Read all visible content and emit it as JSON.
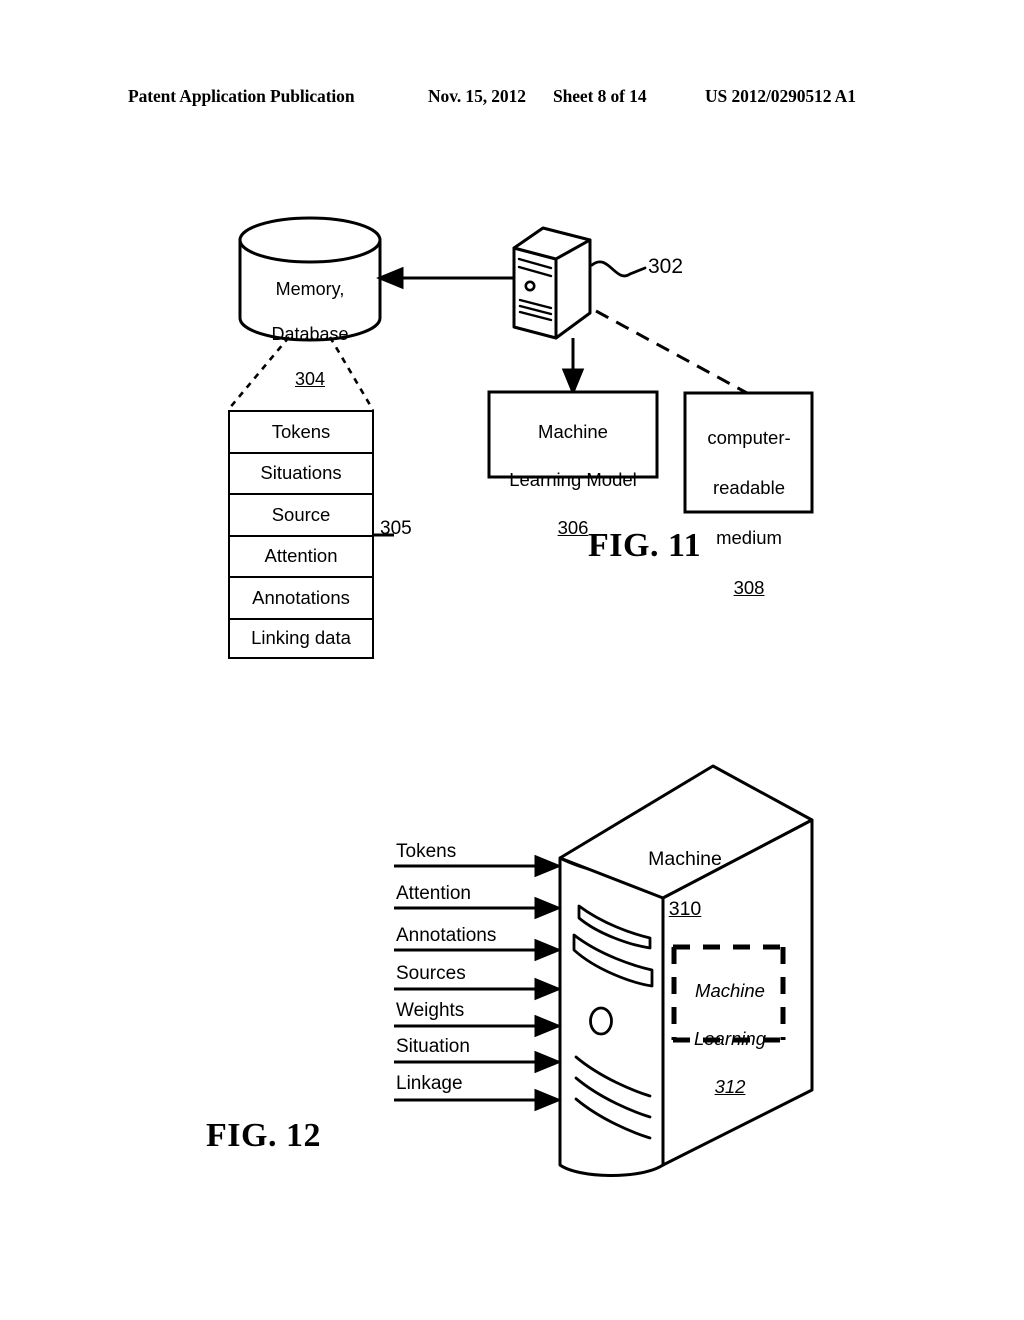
{
  "header": {
    "publication": "Patent Application Publication",
    "date": "Nov. 15, 2012",
    "sheet": "Sheet 8 of 14",
    "patent_number": "US 2012/0290512 A1"
  },
  "fig11": {
    "caption": "FIG. 11",
    "database": {
      "line1": "Memory,",
      "line2": "Database",
      "ref": "304"
    },
    "server_ref": "302",
    "ml_model_box": {
      "line1": "Machine",
      "line2": "Learning Model",
      "ref": "306"
    },
    "crm_box": {
      "line1": "computer-",
      "line2": "readable",
      "line3": "medium",
      "ref": "308"
    },
    "stack_ref": "305",
    "stack_rows": [
      "Tokens",
      "Situations",
      "Source",
      "Attention",
      "Annotations",
      "Linking data"
    ]
  },
  "fig12": {
    "caption": "FIG. 12",
    "machine": {
      "label": "Machine",
      "ref": "310"
    },
    "ml_block": {
      "line1": "Machine",
      "line2": "Learning",
      "ref": "312"
    },
    "inputs": [
      "Tokens",
      "Attention",
      "Annotations",
      "Sources",
      "Weights",
      "Situation",
      "Linkage"
    ]
  },
  "colors": {
    "ink": "#000000",
    "paper": "#ffffff"
  }
}
